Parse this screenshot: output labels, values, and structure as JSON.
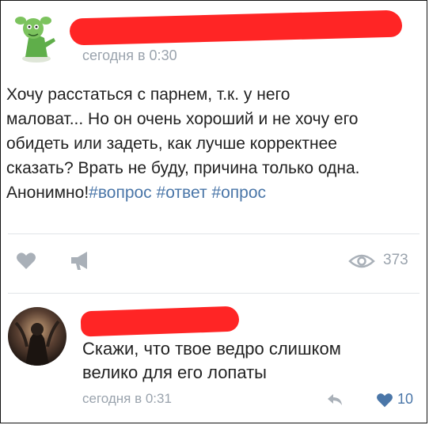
{
  "post": {
    "author_avatar_icon": "green-mascot-avatar",
    "time": "сегодня в 0:30",
    "text_lines": [
      "Хочу расстаться с парнем, т.к. у него",
      "маловат... Но он очень хороший и не хочу его",
      "обидеть или задеть, как лучше корректнее",
      "сказать? Врать не буду, причина только одна."
    ],
    "last_line_text": "Анонимно!",
    "hashtags": [
      "#вопрос",
      "#ответ",
      "#опрос"
    ],
    "views": "373"
  },
  "comment": {
    "author_avatar_icon": "dark-artwork-avatar",
    "text_lines": [
      "Скажи, что твое ведро слишком",
      "велико для его лопаты"
    ],
    "time": "сегодня в 0:31",
    "likes": "10"
  },
  "colors": {
    "redaction": "#ff2525",
    "link": "#4a76a8",
    "muted": "#9aa3ad",
    "icon_gray": "#a9b0b8"
  }
}
